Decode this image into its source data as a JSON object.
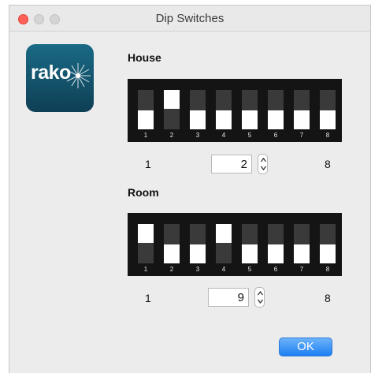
{
  "window": {
    "title": "Dip Switches"
  },
  "logo": {
    "text": "rako"
  },
  "house": {
    "label": "House",
    "switch_numbers": [
      "1",
      "2",
      "3",
      "4",
      "5",
      "6",
      "7",
      "8"
    ],
    "switches_on": [
      false,
      true,
      false,
      false,
      false,
      false,
      false,
      false
    ],
    "min": "1",
    "max": "8",
    "value": "2"
  },
  "room": {
    "label": "Room",
    "switch_numbers": [
      "1",
      "2",
      "3",
      "4",
      "5",
      "6",
      "7",
      "8"
    ],
    "switches_on": [
      true,
      false,
      false,
      true,
      false,
      false,
      false,
      false
    ],
    "min": "1",
    "max": "8",
    "value": "9"
  },
  "ok_label": "OK"
}
